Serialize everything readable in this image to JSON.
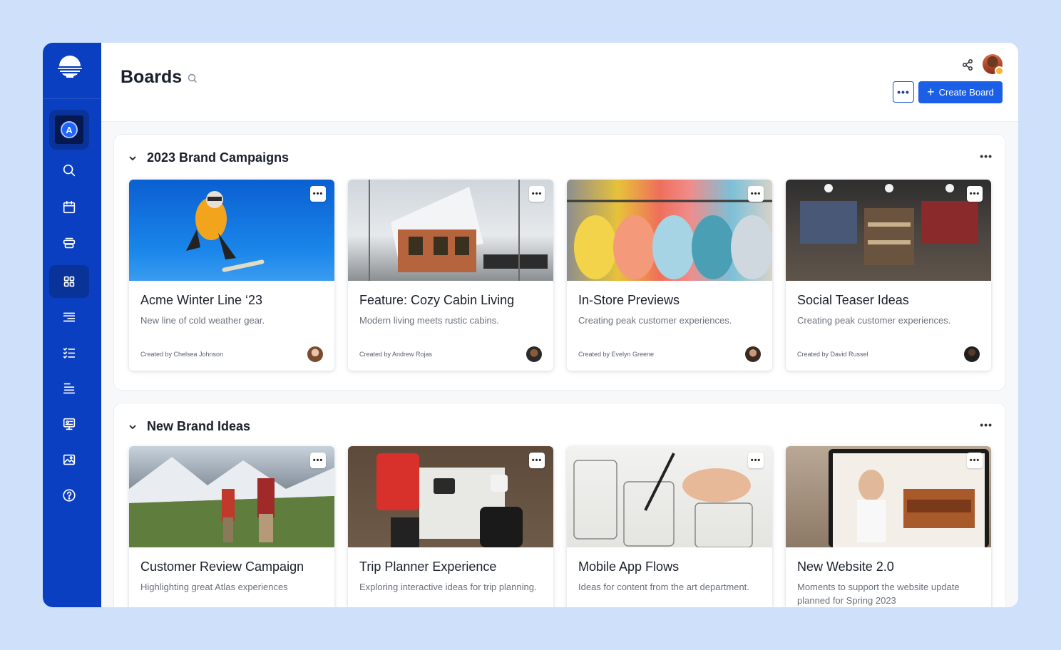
{
  "page": {
    "title": "Boards"
  },
  "sidebar": {
    "workspace_badge": "A",
    "items": [
      {
        "icon": "search-icon"
      },
      {
        "icon": "calendar-icon"
      },
      {
        "icon": "stack-icon"
      },
      {
        "icon": "grid-icon",
        "active": true
      },
      {
        "icon": "list-icon"
      },
      {
        "icon": "checklist-icon"
      },
      {
        "icon": "align-icon"
      },
      {
        "icon": "presentation-icon"
      },
      {
        "icon": "image-icon"
      },
      {
        "icon": "help-icon"
      }
    ]
  },
  "header": {
    "more_label": "•••",
    "create_label": "Create Board"
  },
  "sections": [
    {
      "title": "2023 Brand Campaigns",
      "more_label": "•••",
      "cards": [
        {
          "title": "Acme Winter Line ‘23",
          "desc": "New line of cold weather gear.",
          "creator": "Created by Chelsea Johnson",
          "more": "•••"
        },
        {
          "title": "Feature: Cozy Cabin Living",
          "desc": "Modern living meets rustic cabins.",
          "creator": "Created by Andrew Rojas",
          "more": "•••"
        },
        {
          "title": "In-Store Previews",
          "desc": "Creating peak customer experiences.",
          "creator": "Created by Evelyn Greene",
          "more": "•••"
        },
        {
          "title": "Social Teaser Ideas",
          "desc": "Creating peak customer experiences.",
          "creator": "Created by David Russel",
          "more": "•••"
        }
      ]
    },
    {
      "title": "New Brand Ideas",
      "more_label": "•••",
      "cards": [
        {
          "title": "Customer Review Campaign",
          "desc": "Highlighting great Atlas experiences",
          "more": "•••"
        },
        {
          "title": "Trip Planner Experience",
          "desc": "Exploring interactive ideas for trip planning.",
          "more": "•••"
        },
        {
          "title": "Mobile App Flows",
          "desc": "Ideas for content from the art department.",
          "more": "•••"
        },
        {
          "title": "New Website 2.0",
          "desc": "Moments to support the website update planned for Spring 2023",
          "more": "•••"
        }
      ]
    }
  ],
  "colors": {
    "sidebar": "#0b3fc2",
    "accent": "#1b5fe6",
    "background": "#cfe0fb"
  }
}
